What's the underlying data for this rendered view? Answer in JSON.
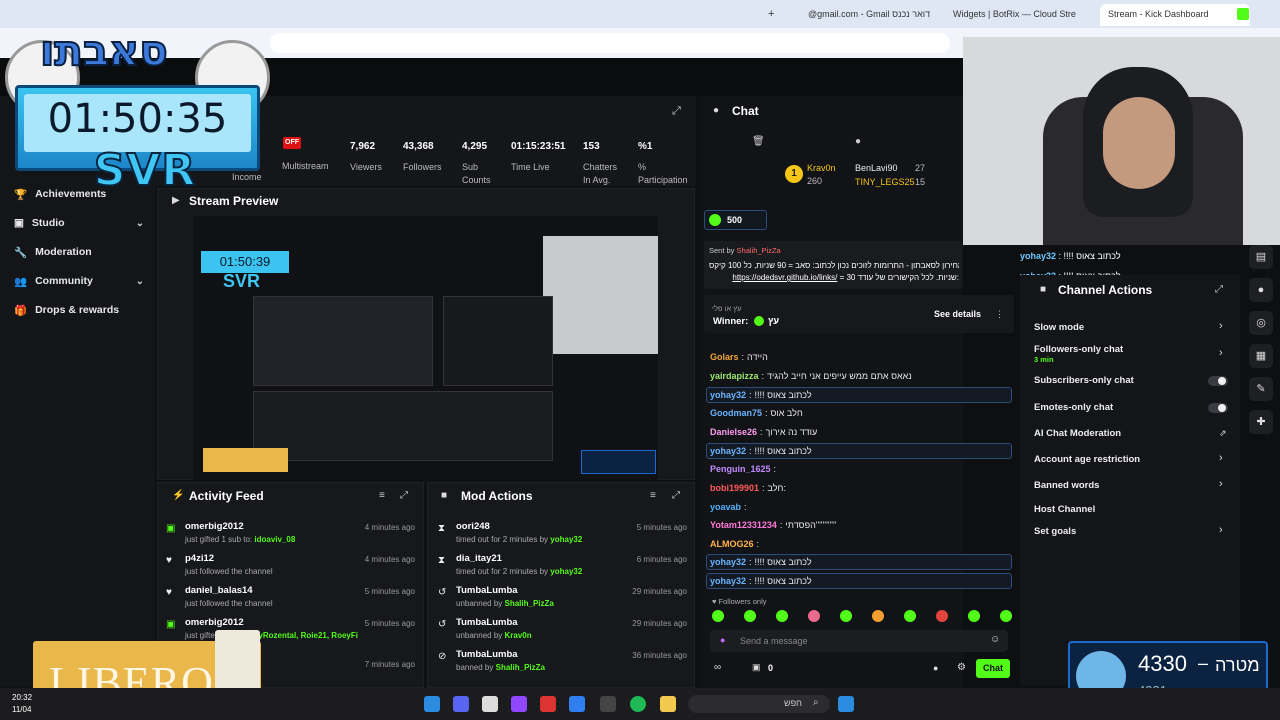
{
  "browser": {
    "tabs": [
      {
        "label": "@gmail.com - Gmail דואר נכנס",
        "active": false
      },
      {
        "label": "Widgets | BotRix — Cloud Stre",
        "active": false
      },
      {
        "label": "Stream - Kick Dashboard",
        "active": true
      }
    ]
  },
  "overlay": {
    "brand": "סאבתו",
    "timer": "01:50:35",
    "svr": "SVR",
    "sponsor": "LIBERO",
    "goal": {
      "value": "4330",
      "label": "מטרה",
      "dash": "–",
      "sub": "4321"
    }
  },
  "sidebar": {
    "items": [
      {
        "label": "Achievements",
        "icon": "trophy-icon",
        "has_chevron": false
      },
      {
        "label": "Studio",
        "icon": "tv-icon",
        "has_chevron": true
      },
      {
        "label": "Moderation",
        "icon": "wrench-icon",
        "has_chevron": false
      },
      {
        "label": "Community",
        "icon": "people-icon",
        "has_chevron": true
      },
      {
        "label": "Drops & rewards",
        "icon": "gift-icon",
        "has_chevron": false
      }
    ]
  },
  "stats": {
    "income_label": "Income",
    "multistream_badge": "OFF",
    "multistream_label": "Multistream",
    "items": [
      {
        "value": "7,962",
        "label": "Viewers"
      },
      {
        "value": "43,368",
        "label": "Followers"
      },
      {
        "value": "4,295",
        "label": "Sub Counts"
      },
      {
        "value": "01:15:23:51",
        "label": "Time Live"
      },
      {
        "value": "153",
        "label": "Chatters In Avg."
      },
      {
        "value": "%1",
        "label": "% Participation"
      }
    ]
  },
  "preview": {
    "title": "Stream Preview",
    "timer": "01:50:39",
    "svr": "SVR"
  },
  "activity": {
    "title": "Activity Feed",
    "items": [
      {
        "name": "omerbig2012",
        "text": "just gifted 1 sub to:",
        "target": "idoaviv_08",
        "time": "4 minutes ago",
        "icon": "gift-icon"
      },
      {
        "name": "p4zi12",
        "text": "just followed the channel",
        "target": "",
        "time": "4 minutes ago",
        "icon": "heart-icon"
      },
      {
        "name": "daniel_balas14",
        "text": "just followed the channel",
        "target": "",
        "time": "5 minutes ago",
        "icon": "heart-icon"
      },
      {
        "name": "omerbig2012",
        "text": "just gifted 5 s",
        "target": "21, RoyRozental, Roie21, RoeyFi",
        "time": "5 minutes ago",
        "icon": "gift-icon"
      },
      {
        "name": "",
        "text": "",
        "target": "",
        "time": "7 minutes ago",
        "icon": ""
      }
    ]
  },
  "mod": {
    "title": "Mod Actions",
    "items": [
      {
        "name": "oori248",
        "text": "timed out for 2 minutes by",
        "by": "yohay32",
        "time": "5 minutes ago",
        "icon": "hourglass-icon"
      },
      {
        "name": "dia_itay21",
        "text": "timed out for 2 minutes by",
        "by": "yohay32",
        "time": "6 minutes ago",
        "icon": "hourglass-icon"
      },
      {
        "name": "TumbaLumba",
        "text": "unbanned by",
        "by": "Shalih_PizZa",
        "time": "29 minutes ago",
        "icon": "undo-icon"
      },
      {
        "name": "TumbaLumba",
        "text": "unbanned by",
        "by": "Krav0n",
        "time": "29 minutes ago",
        "icon": "undo-icon"
      },
      {
        "name": "TumbaLumba",
        "text": "banned by",
        "by": "Shalih_PizZa",
        "time": "36 minutes ago",
        "icon": "ban-icon"
      }
    ]
  },
  "chat": {
    "title": "Chat",
    "leaderboard": [
      {
        "rank": "1",
        "name": "Krav0n",
        "points": "260"
      },
      {
        "name": "BenLavi90",
        "points": "27"
      },
      {
        "name": "TINY_LEGS25",
        "points": "15"
      }
    ],
    "points_badge": "500",
    "pinned": {
      "sent_by_label": "Sent by",
      "sent_by": "Shalih_PizZa",
      "line1": "מחירון לסאבתון - התרומות לזוכים נכון לכתוב: סאב = 90 שניות, כל 100 קיקס",
      "line2": "= 30 שניות. לכל הקישורים של עודד:",
      "link": "https://odedsvr.github.io/links/"
    },
    "winner_label": "Winner:",
    "winner_sub": "עץ או פלי",
    "winner_value": "עץ",
    "see_details": "See details",
    "messages": [
      {
        "user": "Golars",
        "text": "היידה",
        "color": "#f2a53a",
        "hl": false
      },
      {
        "user": "yairdapizza",
        "text": "נאאס אתם ממש עייפים אני חייב להגיד",
        "color": "#9de86d",
        "hl": false
      },
      {
        "user": "yohay32",
        "text": "!!!! לכתוב צאוס",
        "color": "#69b5ff",
        "hl": true
      },
      {
        "user": "Goodman75",
        "text": "חלב אוס",
        "color": "#69b5ff",
        "hl": false
      },
      {
        "user": "Danielse26",
        "text": "עודד נה אירוך",
        "color": "#ff9cf0",
        "hl": false
      },
      {
        "user": "yohay32",
        "text": "!!!! לכתוב צאוס",
        "color": "#69b5ff",
        "hl": true
      },
      {
        "user": "Penguin_1625",
        "text": "",
        "color": "#c08bff",
        "hl": false
      },
      {
        "user": "bobi199901",
        "text": "חלב:",
        "color": "#ff5a5a",
        "hl": false
      },
      {
        "user": "yoavab",
        "text": "",
        "color": "#4fb1ff",
        "hl": false
      },
      {
        "user": "Yotam12331234",
        "text": "הפסדתי''''''''''''",
        "color": "#ff7ad9",
        "hl": false
      },
      {
        "user": "ALMOG26",
        "text": "",
        "color": "#ffb347",
        "hl": false
      },
      {
        "user": "yohay32",
        "text": "!!!! לכתוב צאוס",
        "color": "#69b5ff",
        "hl": true
      },
      {
        "user": "yohay32",
        "text": "!!!! לכתוב צאוס",
        "color": "#69b5ff",
        "hl": true
      }
    ],
    "followers_only": "Followers only",
    "placeholder": "Send a message",
    "count": "0",
    "send": "Chat"
  },
  "overlay_chat": [
    {
      "user": "yohay32",
      "text": "!!!! לכתוב צאוס"
    },
    {
      "user": "yohay32",
      "text": "!!!! לכתוב צאוס"
    }
  ],
  "channel_actions": {
    "title": "Channel Actions",
    "items": [
      {
        "label": "Slow mode",
        "control": "chevron"
      },
      {
        "label": "Followers-only chat",
        "sub": "3 min",
        "control": "chevron"
      },
      {
        "label": "Subscribers-only chat",
        "control": "toggle"
      },
      {
        "label": "Emotes-only chat",
        "control": "toggle"
      },
      {
        "label": "AI Chat Moderation",
        "control": "external"
      },
      {
        "label": "Account age restriction",
        "control": "chevron"
      },
      {
        "label": "Banned words",
        "control": "chevron"
      },
      {
        "label": "Host Channel",
        "control": "none"
      },
      {
        "label": "Set goals",
        "control": "chevron"
      }
    ]
  },
  "taskbar": {
    "search": "חפש",
    "time": "20:32",
    "date": "11/04"
  },
  "colors": {
    "kick_green": "#53fc18",
    "offline_red": "#dd1111",
    "timer_blue": "#3bc4f0"
  }
}
